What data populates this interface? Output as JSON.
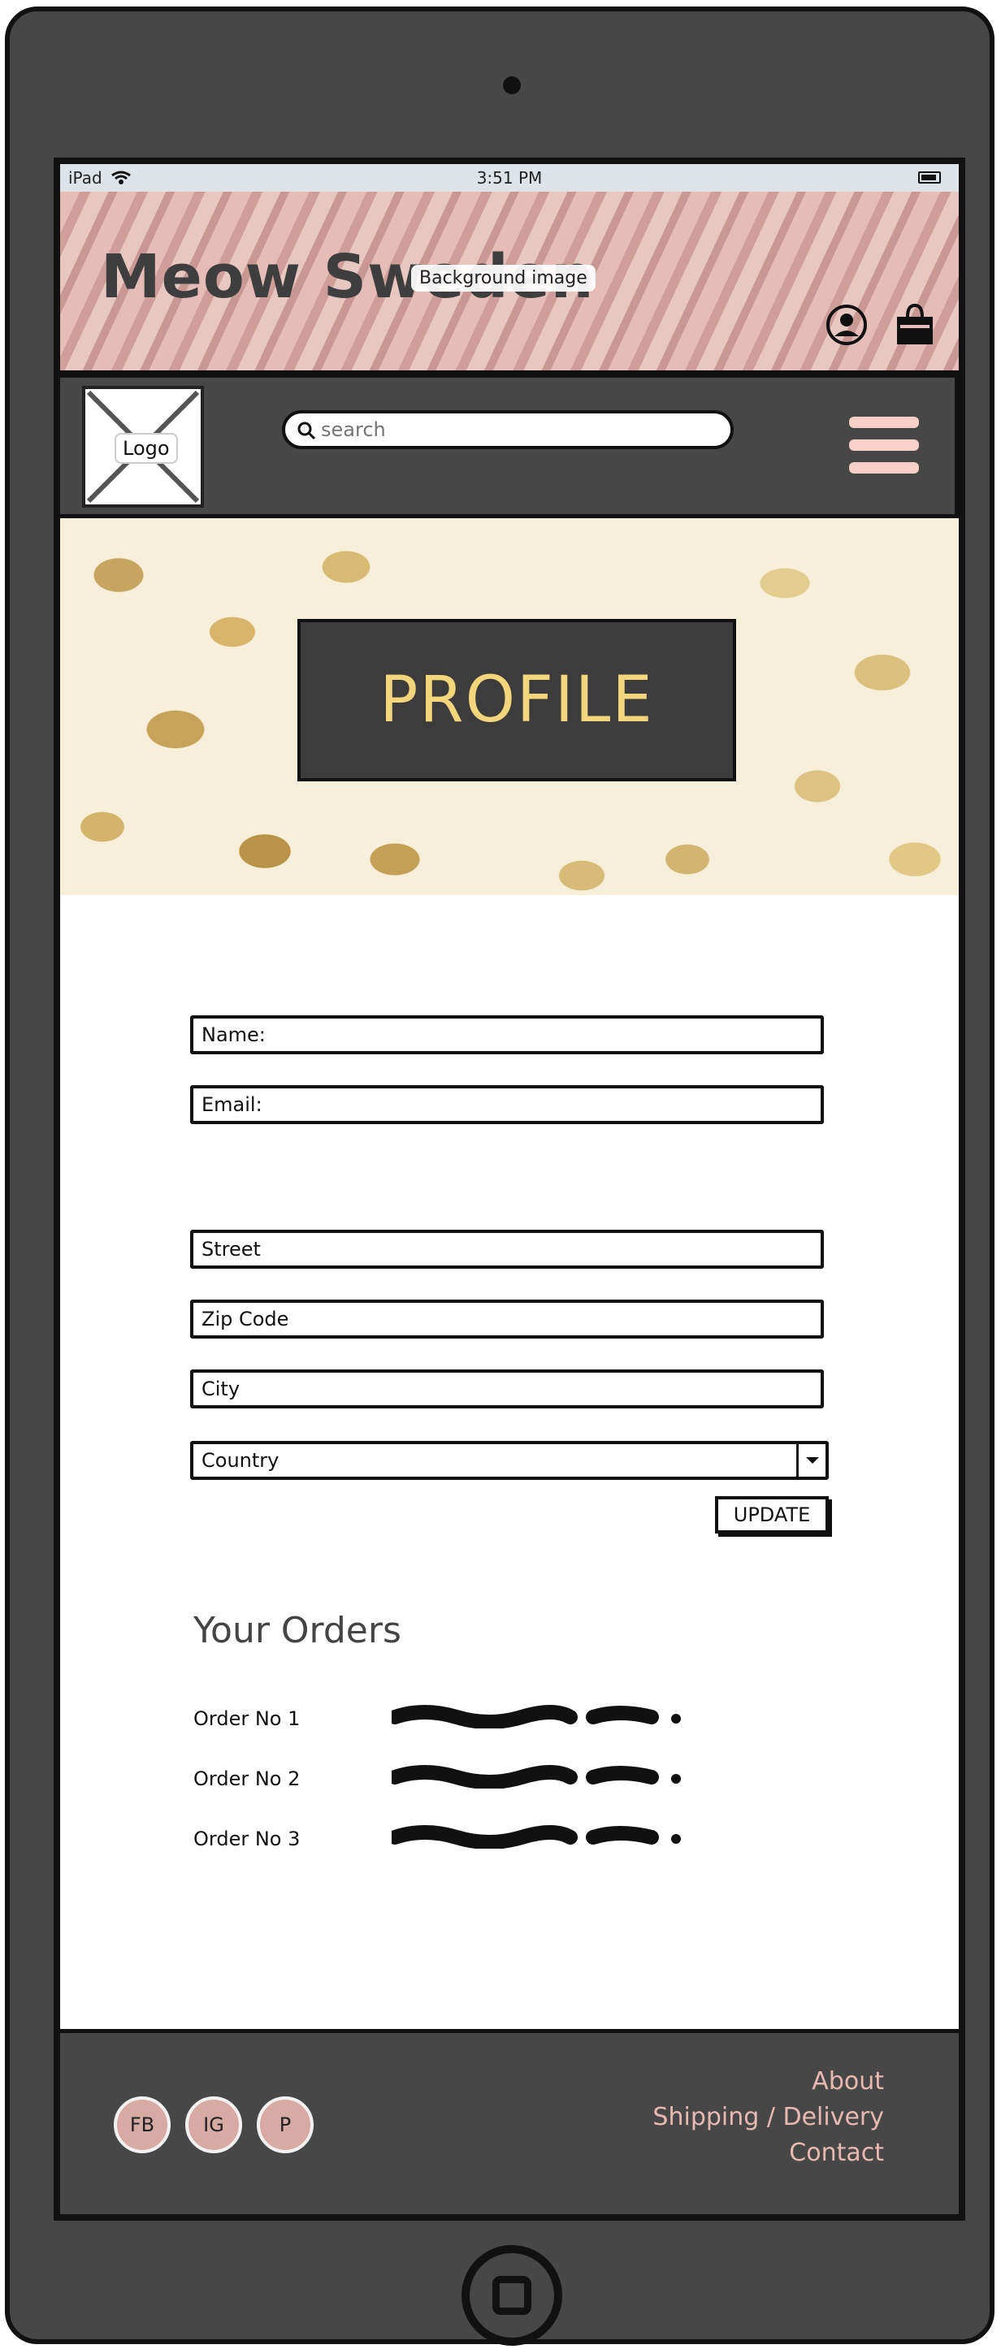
{
  "status_bar": {
    "device": "iPad",
    "time": "3:51 PM"
  },
  "header": {
    "brand": "Meow Sweden",
    "background_label": "Background image"
  },
  "nav": {
    "logo_label": "Logo",
    "search_placeholder": "search"
  },
  "hero": {
    "title": "PROFILE"
  },
  "form": {
    "name_label": "Name:",
    "email_label": "Email:",
    "street_label": "Street",
    "zip_label": "Zip Code",
    "city_label": "City",
    "country_label": "Country",
    "update_label": "UPDATE"
  },
  "orders": {
    "title": "Your Orders",
    "items": [
      {
        "label": "Order No 1"
      },
      {
        "label": "Order No 2"
      },
      {
        "label": "Order No 3"
      }
    ]
  },
  "footer": {
    "social": [
      "FB",
      "IG",
      "P"
    ],
    "links": [
      "About",
      "Shipping / Delivery",
      "Contact"
    ]
  },
  "colors": {
    "device": "#474747",
    "accent_pink": "#e8b9b0",
    "hero_gold": "#f3d57b",
    "social_bg": "#d7aaa4"
  },
  "icons": [
    "wifi-icon",
    "battery-icon",
    "user-icon",
    "shopping-bag-icon",
    "search-icon",
    "hamburger-menu-icon",
    "chevron-down-icon",
    "home-button-icon"
  ]
}
